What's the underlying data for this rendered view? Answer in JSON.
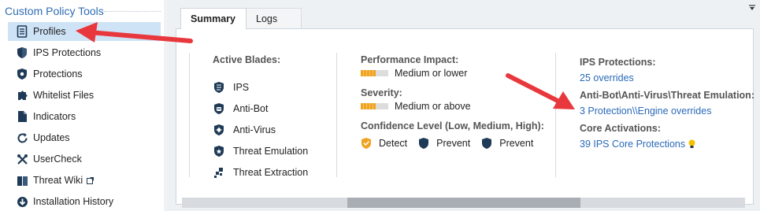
{
  "sidebar": {
    "title": "Custom Policy Tools",
    "items": [
      {
        "label": "Profiles",
        "icon": "document-icon",
        "selected": true
      },
      {
        "label": "IPS Protections",
        "icon": "shield-icon"
      },
      {
        "label": "Protections",
        "icon": "shield-star-icon"
      },
      {
        "label": "Whitelist Files",
        "icon": "puzzle-icon"
      },
      {
        "label": "Indicators",
        "icon": "file-icon"
      },
      {
        "label": "Updates",
        "icon": "refresh-icon"
      },
      {
        "label": "UserCheck",
        "icon": "tools-icon"
      },
      {
        "label": "Threat Wiki",
        "icon": "book-icon",
        "external": true
      },
      {
        "label": "Installation History",
        "icon": "download-icon"
      }
    ]
  },
  "tabs": [
    {
      "label": "Summary",
      "active": true
    },
    {
      "label": "Logs",
      "active": false
    }
  ],
  "summary": {
    "active_blades": {
      "heading": "Active Blades:",
      "items": [
        {
          "label": "IPS",
          "icon": "ips-shield-icon"
        },
        {
          "label": "Anti-Bot",
          "icon": "anti-bot-icon"
        },
        {
          "label": "Anti-Virus",
          "icon": "anti-virus-icon"
        },
        {
          "label": "Threat Emulation",
          "icon": "threat-emulation-icon"
        },
        {
          "label": "Threat Extraction",
          "icon": "threat-extraction-icon"
        }
      ]
    },
    "performance": {
      "heading": "Performance Impact:",
      "value": "Medium or lower",
      "level": 0.55
    },
    "severity": {
      "heading": "Severity:",
      "value": "Medium or above",
      "level": 0.55
    },
    "confidence": {
      "heading": "Confidence Level (Low, Medium, High):",
      "items": [
        {
          "label": "Detect",
          "icon": "detect-shield-icon",
          "color": "#f0a322"
        },
        {
          "label": "Prevent",
          "icon": "prevent-shield-icon",
          "color": "#1f3a56"
        },
        {
          "label": "Prevent",
          "icon": "prevent-shield-icon",
          "color": "#1f3a56"
        }
      ]
    },
    "ips_protections": {
      "heading": "IPS Protections:",
      "link": "25 overrides"
    },
    "ab_av_te": {
      "heading": "Anti-Bot\\Anti-Virus\\Threat Emulation:",
      "link": "3 Protection\\\\Engine overrides"
    },
    "core_activations": {
      "heading": "Core Activations:",
      "link": "39 IPS Core Protections"
    }
  },
  "colors": {
    "accent": "#2a6ab8",
    "selected_bg": "#cfe3f7",
    "arrow": "#e8383d"
  }
}
